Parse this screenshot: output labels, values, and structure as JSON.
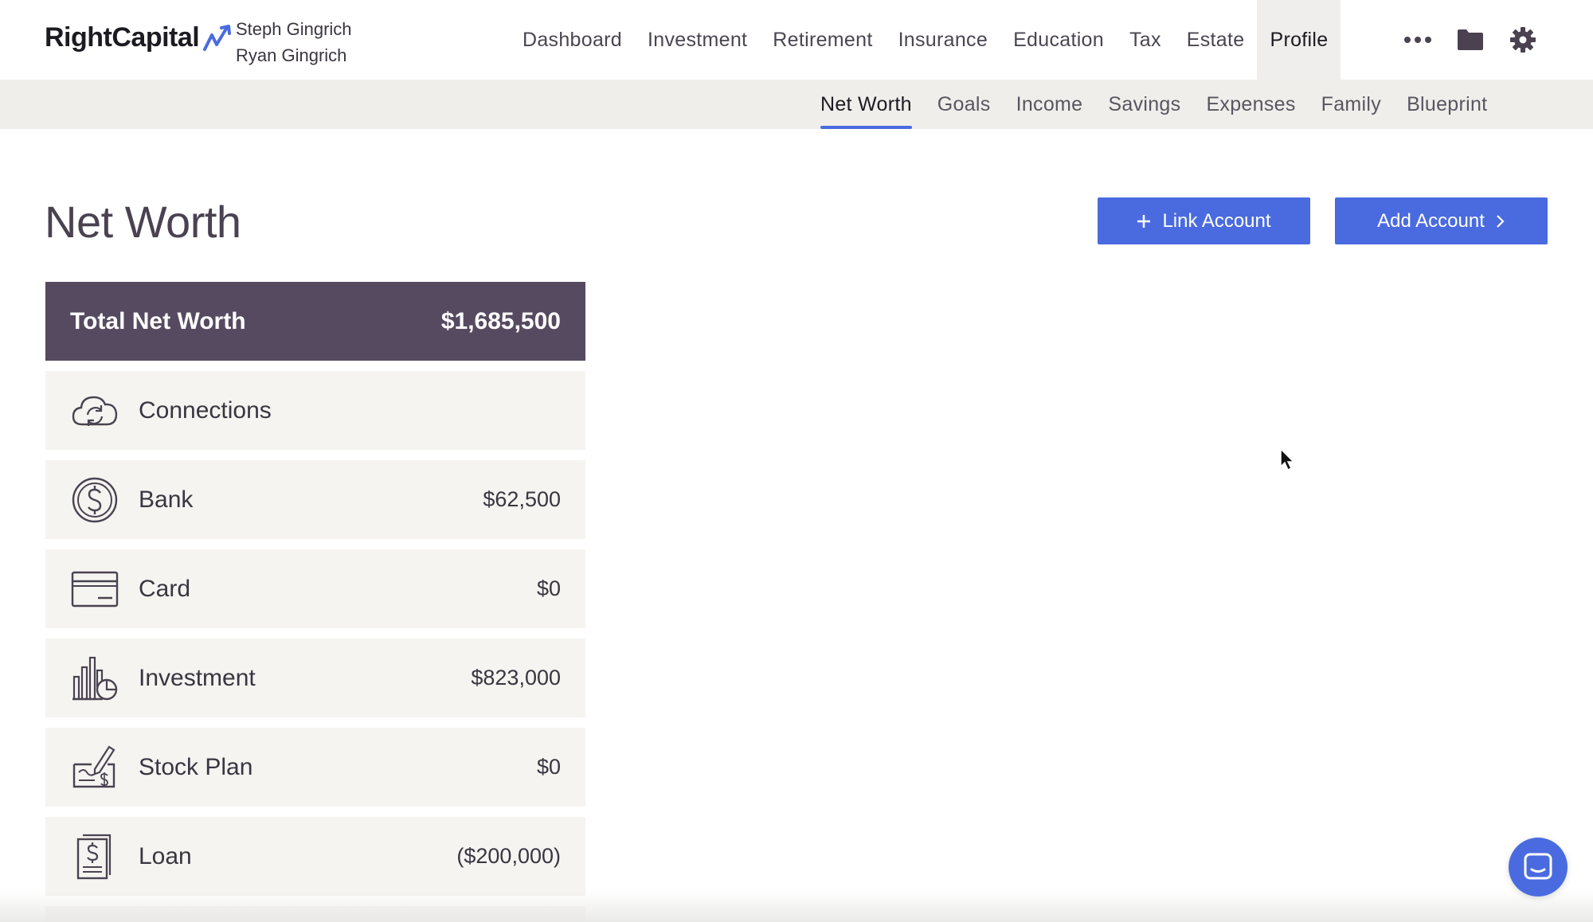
{
  "brand": {
    "name": "RightCapital",
    "accent": "#4a6be0"
  },
  "clients": [
    "Steph Gingrich",
    "Ryan Gingrich"
  ],
  "main_nav": [
    {
      "label": "Dashboard",
      "active": false
    },
    {
      "label": "Investment",
      "active": false
    },
    {
      "label": "Retirement",
      "active": false
    },
    {
      "label": "Insurance",
      "active": false
    },
    {
      "label": "Education",
      "active": false
    },
    {
      "label": "Tax",
      "active": false
    },
    {
      "label": "Estate",
      "active": false
    },
    {
      "label": "Profile",
      "active": true
    }
  ],
  "top_icons": [
    "more-icon",
    "folder-icon",
    "gear-icon"
  ],
  "sub_nav": [
    {
      "label": "Net Worth",
      "active": true
    },
    {
      "label": "Goals",
      "active": false
    },
    {
      "label": "Income",
      "active": false
    },
    {
      "label": "Savings",
      "active": false
    },
    {
      "label": "Expenses",
      "active": false
    },
    {
      "label": "Family",
      "active": false
    },
    {
      "label": "Blueprint",
      "active": false
    }
  ],
  "page": {
    "title": "Net Worth",
    "link_account_label": "Link Account",
    "add_account_label": "Add Account"
  },
  "total": {
    "label": "Total Net Worth",
    "value": "$1,685,500"
  },
  "accounts": [
    {
      "label": "Connections",
      "value": "",
      "icon": "cloud-sync-icon"
    },
    {
      "label": "Bank",
      "value": "$62,500",
      "icon": "dollar-coin-icon"
    },
    {
      "label": "Card",
      "value": "$0",
      "icon": "credit-card-icon"
    },
    {
      "label": "Investment",
      "value": "$823,000",
      "icon": "investment-chart-icon"
    },
    {
      "label": "Stock Plan",
      "value": "$0",
      "icon": "stock-plan-check-icon"
    },
    {
      "label": "Loan",
      "value": "($200,000)",
      "icon": "loan-document-icon"
    }
  ],
  "colors": {
    "total_card_bg": "#564a60",
    "row_bg": "#f6f4f1",
    "subnav_bg": "#efeeeb"
  }
}
